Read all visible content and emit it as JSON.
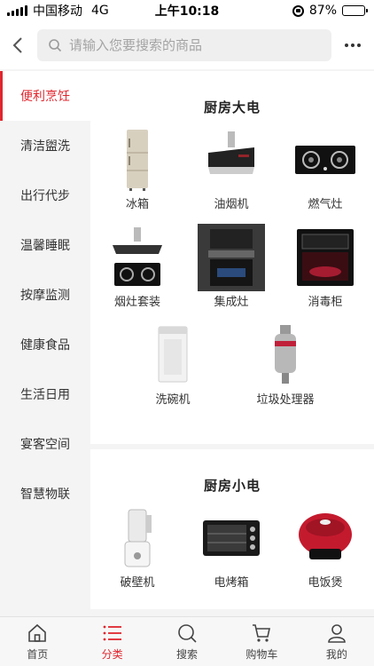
{
  "status_bar": {
    "carrier": "中国移动",
    "network": "4G",
    "time": "上午10:18",
    "battery": "87%",
    "battery_level": 0.87
  },
  "header": {
    "search_placeholder": "请输入您要搜索的商品",
    "back_icon": "chevron-left-icon",
    "more_icon": "more-icon"
  },
  "sidebar": {
    "items": [
      {
        "label": "便利烹饪",
        "active": true
      },
      {
        "label": "清洁盥洗"
      },
      {
        "label": "出行代步"
      },
      {
        "label": "温馨睡眠"
      },
      {
        "label": "按摩监测"
      },
      {
        "label": "健康食品"
      },
      {
        "label": "生活日用"
      },
      {
        "label": "宴客空间"
      },
      {
        "label": "智慧物联"
      }
    ]
  },
  "sections": [
    {
      "title": "厨房大电",
      "products": [
        {
          "label": "冰箱"
        },
        {
          "label": "油烟机"
        },
        {
          "label": "燃气灶"
        },
        {
          "label": "烟灶套装"
        },
        {
          "label": "集成灶"
        },
        {
          "label": "消毒柜"
        },
        {
          "label": "洗碗机"
        },
        {
          "label": "垃圾处理器"
        }
      ]
    },
    {
      "title": "厨房小电",
      "products": [
        {
          "label": "破壁机"
        },
        {
          "label": "电烤箱"
        },
        {
          "label": "电饭煲"
        }
      ]
    }
  ],
  "tab_bar": {
    "tabs": [
      {
        "label": "首页",
        "icon": "home-icon"
      },
      {
        "label": "分类",
        "icon": "category-icon",
        "active": true
      },
      {
        "label": "搜索",
        "icon": "search-icon"
      },
      {
        "label": "购物车",
        "icon": "cart-icon"
      },
      {
        "label": "我的",
        "icon": "user-icon"
      }
    ]
  },
  "colors": {
    "accent": "#e0262e",
    "sidebar_bg": "#f4f4f4",
    "card_bg": "#ffffff"
  }
}
